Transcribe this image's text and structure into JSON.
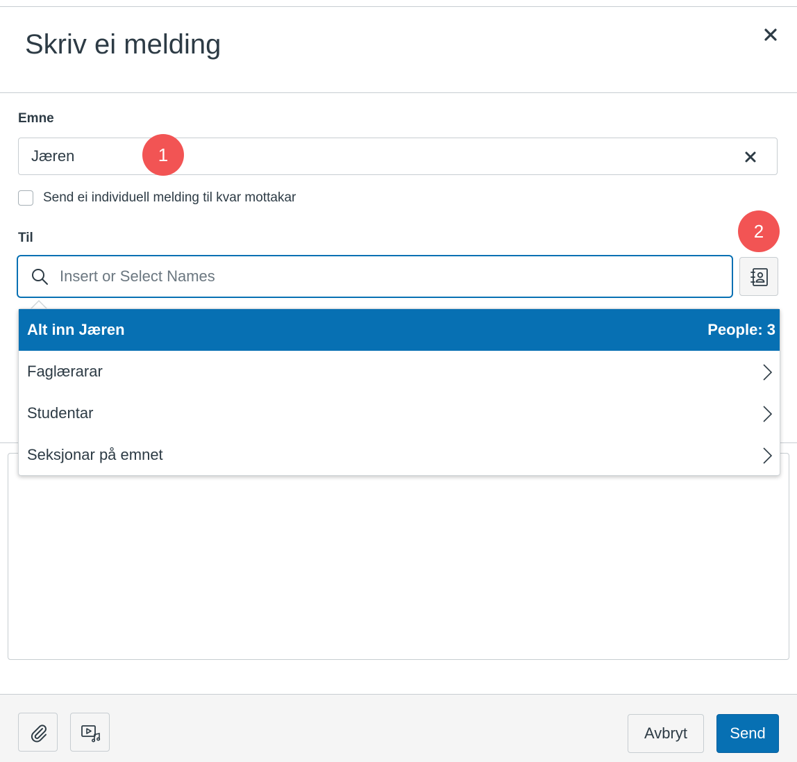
{
  "dialog": {
    "title": "Skriv ei melding",
    "close_icon": "close-icon"
  },
  "subject": {
    "label": "Emne",
    "value": "Jæren",
    "clear_icon": "close-icon"
  },
  "individual_message": {
    "label": "Send ei individuell melding til kvar mottakar",
    "checked": false
  },
  "to": {
    "label": "Til",
    "placeholder": "Insert or Select Names",
    "search_icon": "search-icon",
    "address_book_icon": "address-book-icon"
  },
  "recipients_dropdown": {
    "items": [
      {
        "label": "Alt inn Jæren",
        "count": "People: 3",
        "active": true
      },
      {
        "label": "Faglærarar",
        "icon": "chevron-right-icon"
      },
      {
        "label": "Studentar",
        "icon": "chevron-right-icon"
      },
      {
        "label": "Seksjonar på emnet",
        "icon": "chevron-right-icon"
      }
    ]
  },
  "annotations": {
    "badge_1": "1",
    "badge_2": "2",
    "color": "#f25454"
  },
  "footer": {
    "attach_icon": "paperclip-icon",
    "media_icon": "media-icon",
    "cancel_label": "Avbryt",
    "send_label": "Send"
  },
  "colors": {
    "primary": "#0770b3",
    "text": "#2d3b45",
    "border": "#c7cdd1"
  }
}
